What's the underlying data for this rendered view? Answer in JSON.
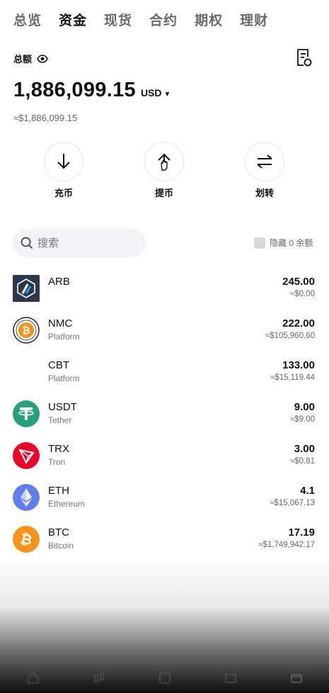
{
  "tabs": [
    {
      "label": "总览",
      "active": false
    },
    {
      "label": "资金",
      "active": true
    },
    {
      "label": "现货",
      "active": false
    },
    {
      "label": "合约",
      "active": false
    },
    {
      "label": "期权",
      "active": false
    },
    {
      "label": "理财",
      "active": false
    }
  ],
  "summary": {
    "total_label": "总额",
    "balance": "1,886,099.15",
    "currency": "USD",
    "approx_value": "≈$1,886,099.15"
  },
  "actions": [
    {
      "label": "充币",
      "icon": "arrow-down-icon"
    },
    {
      "label": "提币",
      "icon": "arrow-up-icon"
    },
    {
      "label": "划转",
      "icon": "transfer-icon"
    }
  ],
  "search": {
    "placeholder": "搜索",
    "value": ""
  },
  "hide_zero": {
    "label": "隐藏 0 余额",
    "checked": false
  },
  "assets": [
    {
      "symbol": "ARB",
      "name": "",
      "amount": "245.00",
      "usd": "≈$0.00",
      "icon": "arb-icon",
      "color": "#213147"
    },
    {
      "symbol": "NMC",
      "name": "Platform",
      "amount": "222.00",
      "usd": "≈$105,960.60",
      "icon": "nmc-icon",
      "color": "#f7931a"
    },
    {
      "symbol": "CBT",
      "name": "Platform",
      "amount": "133.00",
      "usd": "≈$15,119.44",
      "icon": "cbt-icon",
      "color": "#ffffff"
    },
    {
      "symbol": "USDT",
      "name": "Tether",
      "amount": "9.00",
      "usd": "≈$9.00",
      "icon": "tether-icon",
      "color": "#26a17b"
    },
    {
      "symbol": "TRX",
      "name": "Tron",
      "amount": "3.00",
      "usd": "≈$0.81",
      "icon": "tron-icon",
      "color": "#eb0029"
    },
    {
      "symbol": "ETH",
      "name": "Ethereum",
      "amount": "4.1",
      "usd": "≈$15,067.13",
      "icon": "ethereum-icon",
      "color": "#627eea"
    },
    {
      "symbol": "BTC",
      "name": "Bitcoin",
      "amount": "17.19",
      "usd": "≈$1,749,942.17",
      "icon": "bitcoin-icon",
      "color": "#f7931a"
    }
  ],
  "bottom_nav": [
    "home-icon",
    "markets-icon",
    "trade-icon",
    "futures-icon",
    "wallet-icon"
  ]
}
